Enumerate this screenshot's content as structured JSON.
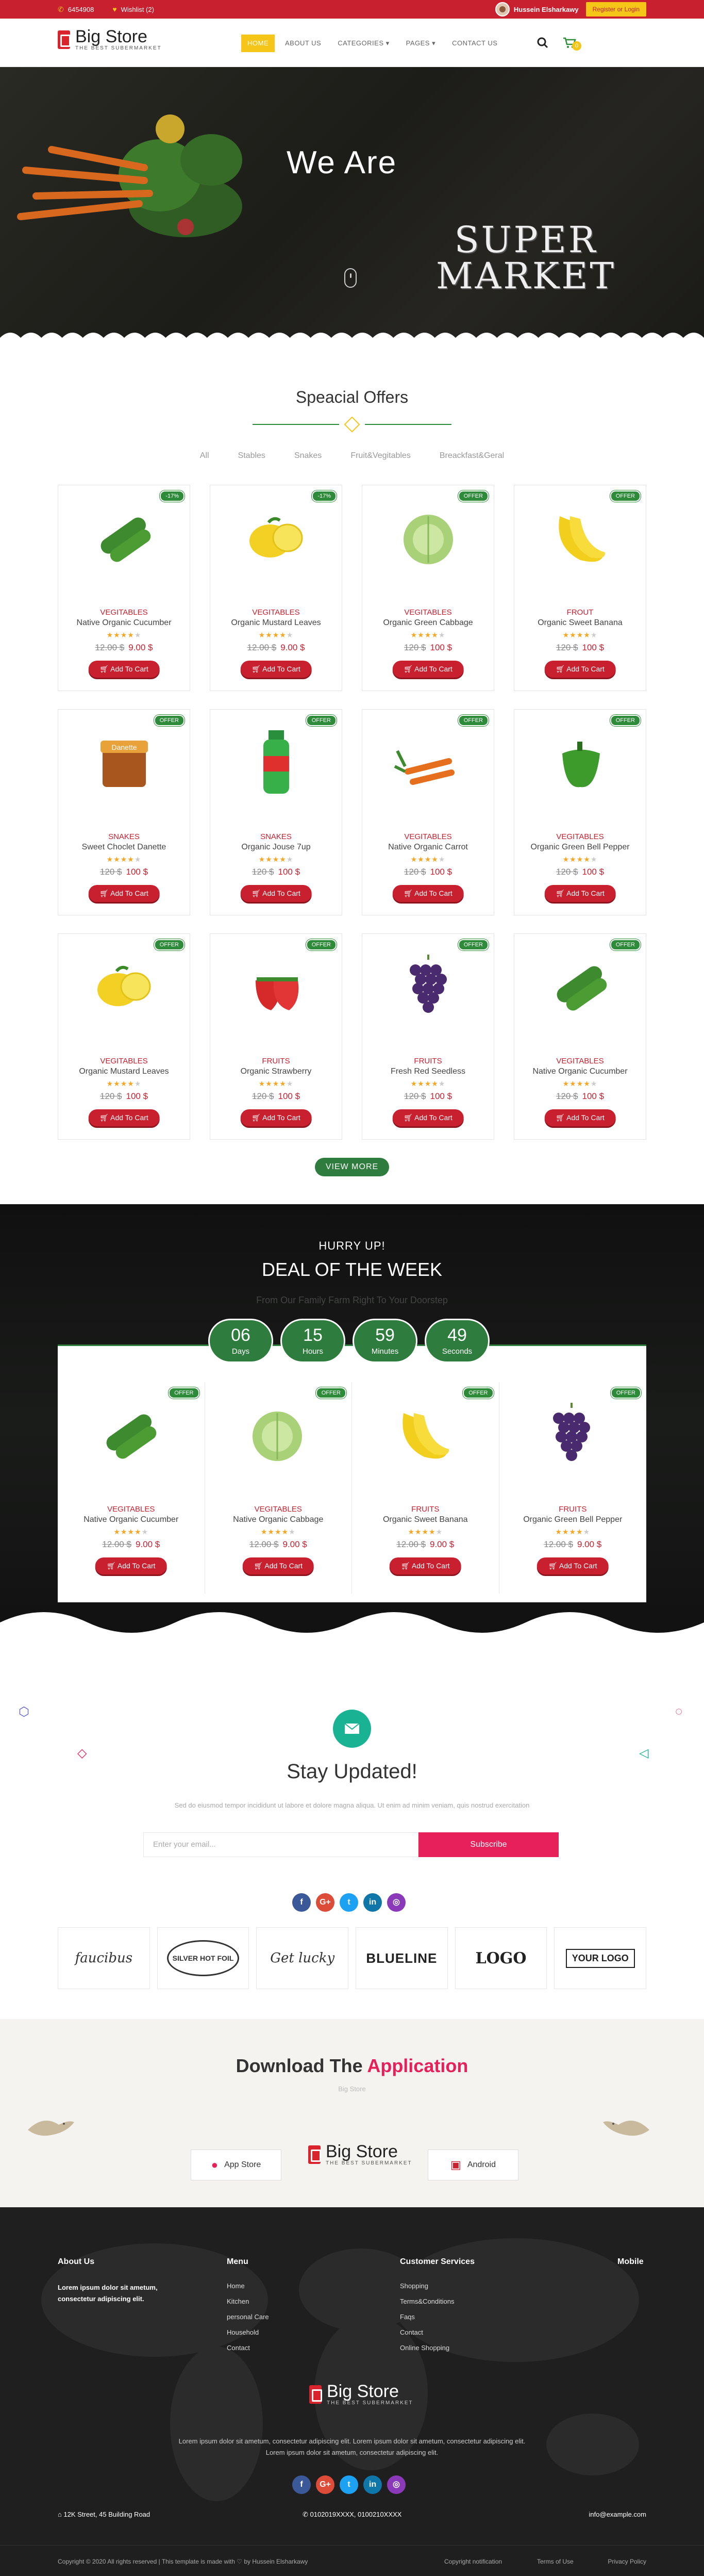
{
  "topbar": {
    "phone": "6454908",
    "wishlist": "Wishlist (2)",
    "user_name": "Hussein Elsharkawy",
    "register_label": "Register or Login"
  },
  "brand": {
    "name": "Big Store",
    "tagline": "THE BEST SUBERMARKET"
  },
  "nav": {
    "items": [
      "HOME",
      "ABOUT US",
      "CATEGORIES ▾",
      "PAGES ▾",
      "CONTACT US"
    ],
    "cart_count": "0",
    "icons": [
      "search-icon",
      "cart-icon"
    ]
  },
  "hero": {
    "line1": "We Are",
    "line2": "SUPER",
    "line3": "MARKET"
  },
  "offers": {
    "title": "Speacial Offers",
    "filters": [
      "All",
      "Stables",
      "Snakes",
      "Fruit&Vegitables",
      "Breackfast&Geral"
    ],
    "products": [
      {
        "badge": "-17%",
        "category": "VEGITABLES",
        "name": "Native Organic Cucumber",
        "old": "12.00 $",
        "new": "9.00 $",
        "rating": 4,
        "image": "cucumber"
      },
      {
        "badge": "-17%",
        "category": "VEGITABLES",
        "name": "Organic Mustard Leaves",
        "old": "12.00 $",
        "new": "9.00 $",
        "rating": 4,
        "image": "lemon"
      },
      {
        "badge": "OFFER",
        "category": "VEGITABLES",
        "name": "Organic Green Cabbage",
        "old": "120 $",
        "new": "100 $",
        "rating": 4,
        "image": "cabbage"
      },
      {
        "badge": "OFFER",
        "category": "FROUT",
        "name": "Organic Sweet Banana",
        "old": "120 $",
        "new": "100 $",
        "rating": 4,
        "image": "banana"
      },
      {
        "badge": "OFFER",
        "category": "SNAKES",
        "name": "Sweet Choclet Danette",
        "old": "120 $",
        "new": "100 $",
        "rating": 4,
        "image": "danette"
      },
      {
        "badge": "OFFER",
        "category": "SNAKES",
        "name": "Organic Jouse 7up",
        "old": "120 $",
        "new": "100 $",
        "rating": 4,
        "image": "bottle"
      },
      {
        "badge": "OFFER",
        "category": "VEGITABLES",
        "name": "Native Organic Carrot",
        "old": "120 $",
        "new": "100 $",
        "rating": 4,
        "image": "carrot"
      },
      {
        "badge": "OFFER",
        "category": "VEGITABLES",
        "name": "Organic Green Bell Pepper",
        "old": "120 $",
        "new": "100 $",
        "rating": 4,
        "image": "pepper"
      },
      {
        "badge": "OFFER",
        "category": "VEGITABLES",
        "name": "Organic Mustard Leaves",
        "old": "120 $",
        "new": "100 $",
        "rating": 4,
        "image": "lemon"
      },
      {
        "badge": "OFFER",
        "category": "FRUITS",
        "name": "Organic Strawberry",
        "old": "120 $",
        "new": "100 $",
        "rating": 4,
        "image": "strawberry"
      },
      {
        "badge": "OFFER",
        "category": "FRUITS",
        "name": "Fresh Red Seedless",
        "old": "120 $",
        "new": "100 $",
        "rating": 4,
        "image": "grapes"
      },
      {
        "badge": "OFFER",
        "category": "VEGITABLES",
        "name": "Native Organic Cucumber",
        "old": "120 $",
        "new": "100 $",
        "rating": 4,
        "image": "cucumber"
      }
    ],
    "add_to_cart": "Add To Cart",
    "view_more": "VIEW MORE"
  },
  "deal": {
    "hurry": "HURRY UP!",
    "title": "DEAL OF THE WEEK",
    "subtitle": "From Our Family Farm Right To Your Doorstep",
    "countdown": [
      {
        "value": "06",
        "label": "Days"
      },
      {
        "value": "15",
        "label": "Hours"
      },
      {
        "value": "59",
        "label": "Minutes"
      },
      {
        "value": "49",
        "label": "Seconds"
      }
    ],
    "products": [
      {
        "badge": "OFFER",
        "category": "VEGITABLES",
        "name": "Native Organic Cucumber",
        "old": "12.00 $",
        "new": "9.00 $",
        "rating": 4,
        "image": "cucumber"
      },
      {
        "badge": "OFFER",
        "category": "VEGITABLES",
        "name": "Native Organic Cabbage",
        "old": "12.00 $",
        "new": "9.00 $",
        "rating": 4,
        "image": "cabbage"
      },
      {
        "badge": "OFFER",
        "category": "FRUITS",
        "name": "Organic Sweet Banana",
        "old": "12.00 $",
        "new": "9.00 $",
        "rating": 4,
        "image": "banana"
      },
      {
        "badge": "OFFER",
        "category": "FRUITS",
        "name": "Organic Green Bell Pepper",
        "old": "12.00 $",
        "new": "9.00 $",
        "rating": 4,
        "image": "grapes"
      }
    ]
  },
  "newsletter": {
    "title": "Stay Updated!",
    "description": "Sed do eiusmod tempor incididunt ut labore et dolore magna aliqua. Ut enim ad minim veniam, quis nostrud exercitation",
    "placeholder": "Enter your email...",
    "button": "Subscribe"
  },
  "socials": [
    {
      "name": "facebook-icon",
      "glyph": "f",
      "color": "#3b5998"
    },
    {
      "name": "google-plus-icon",
      "glyph": "G+",
      "color": "#dd4b39"
    },
    {
      "name": "twitter-icon",
      "glyph": "t",
      "color": "#1da1f2"
    },
    {
      "name": "linkedin-icon",
      "glyph": "in",
      "color": "#0e76a8"
    },
    {
      "name": "instagram-icon",
      "glyph": "◎",
      "color": "#8a3ab9"
    }
  ],
  "brands": [
    "faucibus",
    "SILVER HOT FOIL",
    "Get lucky",
    "BLUELINE",
    "LOGO",
    "YOUR LOGO"
  ],
  "app": {
    "title_prefix": "Download The ",
    "title_highlight": "Application",
    "subtitle": "Big Store",
    "app_store": "App Store",
    "android": "Android"
  },
  "footer": {
    "about_title": "About Us",
    "about_text": "Lorem ipsum dolor sit ametum, consectetur adipiscing elit.",
    "menu_title": "Menu",
    "menu_items": [
      "Home",
      "Kitchen",
      "personal Care",
      "Household",
      "Contact"
    ],
    "cs_title": "Customer Services",
    "cs_items": [
      "Shopping",
      "Terms&Conditions",
      "Faqs",
      "Contact",
      "Online Shopping"
    ],
    "mobile_title": "Mobile",
    "description": "Lorem ipsum dolor sit ametum, consectetur adipiscing elit. Lorem ipsum dolor sit ametum, consectetur adipiscing elit. Lorem ipsum dolor sit ametum, consectetur adipiscing elit.",
    "address": "12K Street, 45 Building Road",
    "phones": "0102019XXXX, 0100210XXXX",
    "email": "info@example.com",
    "copyright": "Copyright © 2020 All rights reserved | This template is made with ♡ by Hussein Elsharkawy",
    "links": [
      "Copyright notification",
      "Terms of Use",
      "Privacy Policy"
    ]
  },
  "colors": {
    "primary_red": "#c8202f",
    "accent_yellow": "#f5c518",
    "green": "#2e7d3e",
    "pink": "#e8205a",
    "teal": "#19b394"
  }
}
